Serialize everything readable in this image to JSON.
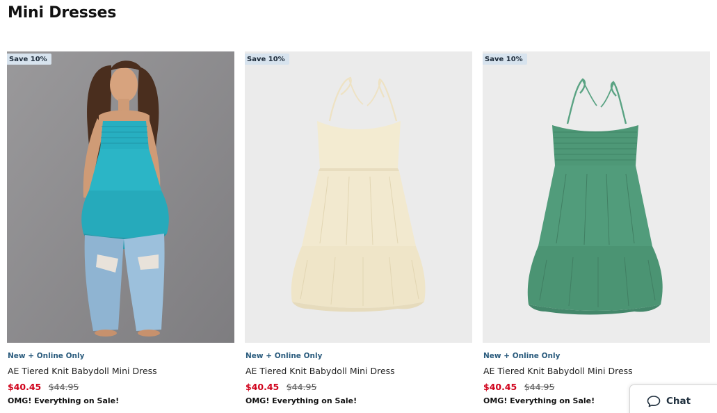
{
  "page": {
    "title": "Mini Dresses"
  },
  "products": [
    {
      "badge": "Save 10%",
      "tag": "New + Online Only",
      "name": "AE Tiered Knit Babydoll Mini Dress",
      "sale_price": "$40.45",
      "original_price": "$44.95",
      "promo": "OMG! Everything on Sale!",
      "image": {
        "background": "#8f8d8f",
        "dress_color": "#2bb5c6",
        "kind": "model-photo"
      }
    },
    {
      "badge": "Save 10%",
      "tag": "New + Online Only",
      "name": "AE Tiered Knit Babydoll Mini Dress",
      "sale_price": "$40.45",
      "original_price": "$44.95",
      "promo": "OMG! Everything on Sale!",
      "image": {
        "background": "#ebebeb",
        "dress_color": "#f2ead3",
        "kind": "flat-lay"
      }
    },
    {
      "badge": "Save 10%",
      "tag": "New + Online Only",
      "name": "AE Tiered Knit Babydoll Mini Dress",
      "sale_price": "$40.45",
      "original_price": "$44.95",
      "promo": "OMG! Everything on Sale!",
      "image": {
        "background": "#ececec",
        "dress_color": "#4f9a78",
        "kind": "flat-lay"
      }
    }
  ],
  "chat": {
    "label": "Chat",
    "icon": "chat-bubble-icon"
  },
  "colors": {
    "sale_red": "#d0021b",
    "tag_blue": "#2a5b7d",
    "badge_bg": "#d7e3ee"
  }
}
